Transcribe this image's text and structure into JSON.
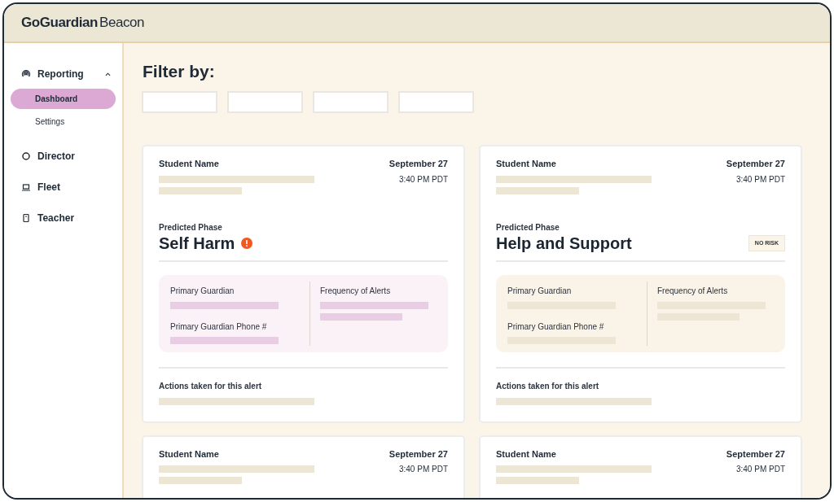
{
  "header": {
    "logo_bold": "GoGuardian",
    "logo_light": "Beacon"
  },
  "sidebar": {
    "items": [
      {
        "label": "Reporting",
        "expanded": true,
        "children": [
          {
            "label": "Dashboard",
            "selected": true
          },
          {
            "label": "Settings",
            "selected": false
          }
        ]
      },
      {
        "label": "Director"
      },
      {
        "label": "Fleet"
      },
      {
        "label": "Teacher"
      }
    ]
  },
  "filter": {
    "title": "Filter by:",
    "fields": [
      {
        "kind": "blank"
      },
      {
        "kind": "blank"
      },
      {
        "kind": "blank"
      },
      {
        "kind": "blank"
      }
    ]
  },
  "cards": [
    {
      "student_label": "Student Name",
      "date": "September 27",
      "time": "3:40 PM PDT",
      "phase_label": "Predicted Phase",
      "phase": "Self Harm",
      "risk": {
        "kind": "alert"
      },
      "color": "#faf2f7",
      "guardian_label": "Primary Guardian",
      "phone_label": "Primary Guardian Phone #",
      "frequency_label": "Frequency of Alerts",
      "actions_label": "Actions taken for this alert"
    },
    {
      "student_label": "Student Name",
      "date": "September 27",
      "time": "3:40 PM PDT",
      "phase_label": "Predicted Phase",
      "phase": "Help and Support",
      "risk": {
        "kind": "badge",
        "text": "NO RISK"
      },
      "color": "#faf3e7",
      "guardian_label": "Primary Guardian",
      "phone_label": "Primary Guardian Phone #",
      "frequency_label": "Frequency of Alerts",
      "actions_label": "Actions taken for this alert"
    },
    {
      "student_label": "Student Name",
      "date": "September 27",
      "time": "3:40 PM PDT"
    },
    {
      "student_label": "Student Name",
      "date": "September 27",
      "time": "3:40 PM PDT"
    }
  ]
}
